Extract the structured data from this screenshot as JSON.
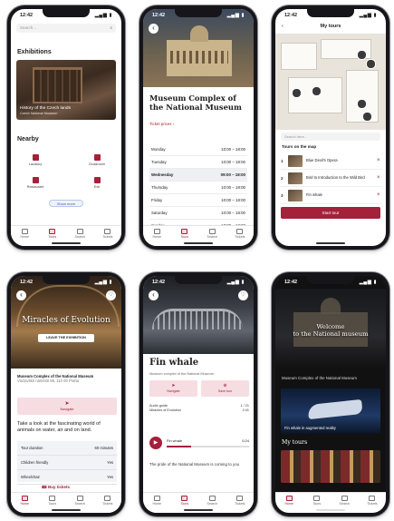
{
  "status": {
    "time": "12:42",
    "battery": "▂▄▆ ▮"
  },
  "tabs": [
    "Home",
    "Tours",
    "Search",
    "Tickets",
    "Discover"
  ],
  "phone1": {
    "search_placeholder": "Search...",
    "filter_icon": "filter-icon",
    "exhibitions_heading": "Exhibitions",
    "featured_title": "History of the Czech lands",
    "featured_sub": "Czech National Museum",
    "nearby_heading": "Nearby",
    "nearby": [
      {
        "label": "Lavatory",
        "icon": "lavatory-icon"
      },
      {
        "label": "Cloakroom",
        "icon": "cloakroom-icon"
      },
      {
        "label": "Restaurant",
        "icon": "restaurant-icon"
      },
      {
        "label": "Exit",
        "icon": "exit-icon"
      }
    ],
    "show_more": "Show more"
  },
  "phone2": {
    "title": "Museum Complex of the National Museum",
    "link": "Ticket prices ›",
    "hours": [
      {
        "day": "Monday",
        "time": "10:00 – 18:00"
      },
      {
        "day": "Tuesday",
        "time": "10:00 – 18:00"
      },
      {
        "day": "Wednesday",
        "time": "09:00 – 18:00"
      },
      {
        "day": "Thursday",
        "time": "10:00 – 18:00"
      },
      {
        "day": "Friday",
        "time": "10:00 – 18:00"
      },
      {
        "day": "Saturday",
        "time": "10:00 – 18:00"
      },
      {
        "day": "Sunday",
        "time": "10:00 – 18:00"
      }
    ]
  },
  "phone3": {
    "title": "My tours",
    "search_placeholder": "Search here...",
    "section": "Tours on the map",
    "items": [
      {
        "n": "1",
        "text": "Blue Devil's Opera"
      },
      {
        "n": "2",
        "text": "Bird to Introduction to the Wild Bird"
      },
      {
        "n": "3",
        "text": "Fin whale"
      }
    ],
    "start": "Start tour"
  },
  "phone4": {
    "title": "Miracles of Evolution",
    "watch": "LEAVE THE EXHIBITION",
    "loc_name": "Museum Complex of the National Museum",
    "loc_addr": "Václavské náměstí 68, 110 00 Praha",
    "navigate": "Navigate",
    "desc": "Take a look at the fascinating world of animals on water, air and on land.",
    "rows": [
      {
        "k": "Tour duration",
        "v": "60 minutes"
      },
      {
        "k": "Children friendly",
        "v": "Yes"
      },
      {
        "k": "Wheelchair",
        "v": "Yes"
      }
    ],
    "buy": "Buy tickets"
  },
  "phone5": {
    "title": "Fin whale",
    "sub": "Museum complex of the National Museum",
    "btns": [
      "Navigate",
      "Save tour"
    ],
    "meta": [
      {
        "k": "Audio guide",
        "v": "1 / 21"
      },
      {
        "k": "Miracles of Evolution",
        "v": "2:41"
      }
    ],
    "audio_title": "Fin whale",
    "audio_time": "0:24",
    "desc": "The pride of the National Museum is coming to you"
  },
  "phone6": {
    "welcome_line1": "Welcome",
    "welcome_line2": "to the National museum",
    "label": "Museum Complex of the National Museum",
    "whale_caption": "Fin whale in augmented reality",
    "my_tours": "My tours"
  }
}
